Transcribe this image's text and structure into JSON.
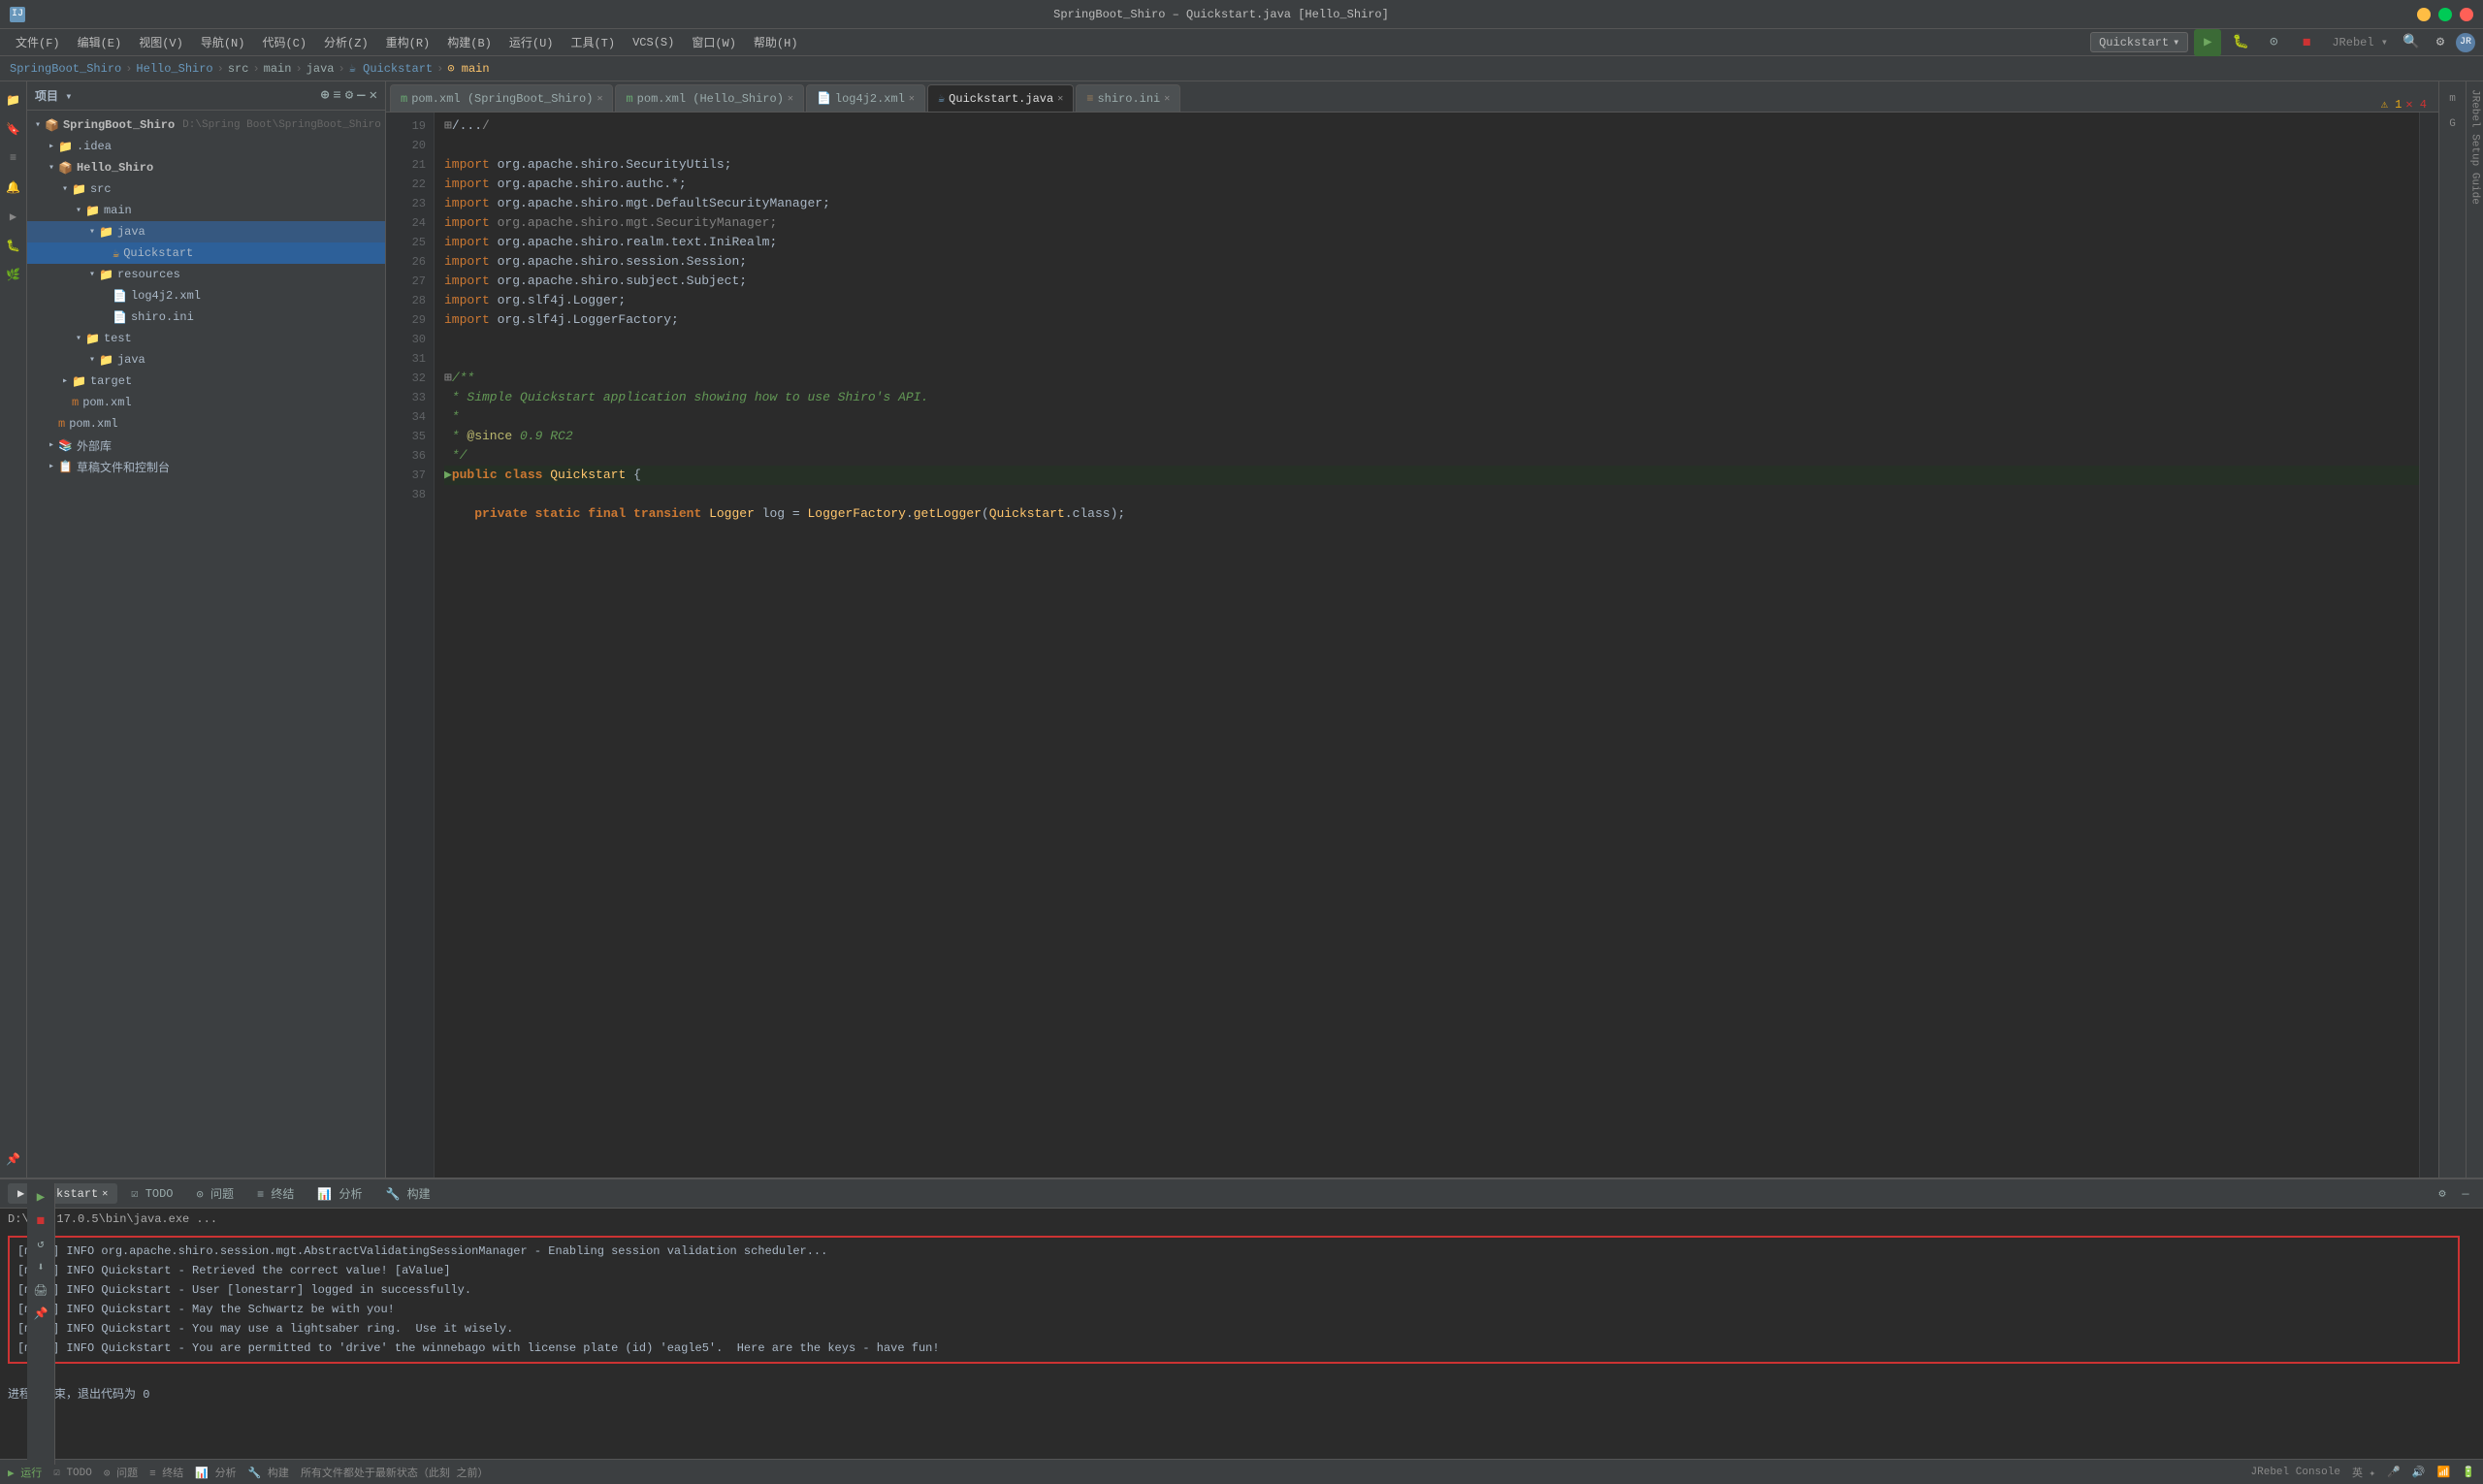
{
  "titlebar": {
    "title": "SpringBoot_Shiro – Quickstart.java [Hello_Shiro]",
    "minimize": "—",
    "maximize": "□",
    "close": "✕"
  },
  "menubar": {
    "items": [
      "文件(F)",
      "编辑(E)",
      "视图(V)",
      "导航(N)",
      "代码(C)",
      "分析(Z)",
      "重构(R)",
      "构建(B)",
      "运行(U)",
      "工具(T)",
      "VCS(S)",
      "窗口(W)",
      "帮助(H)"
    ]
  },
  "breadcrumb": {
    "items": [
      "SpringBoot_Shiro",
      "Hello_Shiro",
      "src",
      "main",
      "java",
      "Quickstart",
      "main"
    ]
  },
  "tabs": [
    {
      "label": "pom.xml (SpringBoot_Shiro)",
      "type": "xml",
      "active": false
    },
    {
      "label": "pom.xml (Hello_Shiro)",
      "type": "xml",
      "active": false
    },
    {
      "label": "log4j2.xml",
      "type": "xml",
      "active": false
    },
    {
      "label": "Quickstart.java",
      "type": "java",
      "active": true
    },
    {
      "label": "shiro.ini",
      "type": "ini",
      "active": false
    }
  ],
  "sidebar": {
    "title": "项目 ▾",
    "tree": [
      {
        "indent": 0,
        "arrow": "▾",
        "icon": "📦",
        "label": "SpringBoot_Shiro",
        "sub": "D:\\Spring Boot\\SpringBoot_Shiro",
        "type": "module"
      },
      {
        "indent": 1,
        "arrow": "▾",
        "icon": "📁",
        "label": ".idea",
        "type": "folder"
      },
      {
        "indent": 1,
        "arrow": "▾",
        "icon": "📁",
        "label": "Hello_Shiro",
        "type": "folder"
      },
      {
        "indent": 2,
        "arrow": "▾",
        "icon": "📁",
        "label": "src",
        "type": "folder"
      },
      {
        "indent": 3,
        "arrow": "▾",
        "icon": "📁",
        "label": "main",
        "type": "folder"
      },
      {
        "indent": 4,
        "arrow": "▾",
        "icon": "📁",
        "label": "java",
        "type": "folder",
        "selected": true
      },
      {
        "indent": 5,
        "arrow": " ",
        "icon": "☕",
        "label": "Quickstart",
        "type": "java"
      },
      {
        "indent": 4,
        "arrow": "▾",
        "icon": "📁",
        "label": "resources",
        "type": "folder"
      },
      {
        "indent": 5,
        "arrow": " ",
        "icon": "📄",
        "label": "log4j2.xml",
        "type": "xml"
      },
      {
        "indent": 5,
        "arrow": " ",
        "icon": "📄",
        "label": "shiro.ini",
        "type": "ini"
      },
      {
        "indent": 3,
        "arrow": "▾",
        "icon": "📁",
        "label": "test",
        "type": "folder"
      },
      {
        "indent": 4,
        "arrow": "▾",
        "icon": "📁",
        "label": "java",
        "type": "folder"
      },
      {
        "indent": 2,
        "arrow": "▾",
        "icon": "📁",
        "label": "target",
        "type": "folder"
      },
      {
        "indent": 2,
        "arrow": " ",
        "icon": "📄",
        "label": "pom.xml",
        "type": "xml"
      },
      {
        "indent": 1,
        "arrow": " ",
        "icon": "📄",
        "label": "pom.xml",
        "type": "xml"
      },
      {
        "indent": 1,
        "arrow": "▾",
        "icon": "📚",
        "label": "外部库",
        "type": "folder"
      },
      {
        "indent": 1,
        "arrow": "▾",
        "icon": "📋",
        "label": "草稿文件和控制台",
        "type": "folder"
      }
    ]
  },
  "editor": {
    "filename": "Quickstart.java",
    "lines": [
      {
        "num": "",
        "content": "/.../",
        "type": "fold"
      },
      {
        "num": "19",
        "content": "",
        "type": "blank"
      },
      {
        "num": "20",
        "content": "import org.apache.shiro.SecurityUtils;",
        "type": "import"
      },
      {
        "num": "21",
        "content": "import org.apache.shiro.authc.*;",
        "type": "import"
      },
      {
        "num": "22",
        "content": "import org.apache.shiro.mgt.DefaultSecurityManager;",
        "type": "import"
      },
      {
        "num": "23",
        "content": "import org.apache.shiro.mgt.SecurityManager;",
        "type": "import"
      },
      {
        "num": "24",
        "content": "import org.apache.shiro.realm.text.IniRealm;",
        "type": "import"
      },
      {
        "num": "25",
        "content": "import org.apache.shiro.session.Session;",
        "type": "import"
      },
      {
        "num": "26",
        "content": "import org.apache.shiro.subject.Subject;",
        "type": "import"
      },
      {
        "num": "27",
        "content": "import org.slf4j.Logger;",
        "type": "import"
      },
      {
        "num": "28",
        "content": "import org.slf4j.LoggerFactory;",
        "type": "import"
      },
      {
        "num": "29",
        "content": "",
        "type": "blank"
      },
      {
        "num": "30",
        "content": "",
        "type": "blank"
      },
      {
        "num": "31",
        "content": "/**",
        "type": "comment"
      },
      {
        "num": "32",
        "content": " * Simple Quickstart application showing how to use Shiro's API.",
        "type": "comment"
      },
      {
        "num": "33",
        "content": " *",
        "type": "comment"
      },
      {
        "num": "34",
        "content": " * @since 0.9 RC2",
        "type": "comment"
      },
      {
        "num": "35",
        "content": " */",
        "type": "comment"
      },
      {
        "num": "36",
        "content": "public class Quickstart {",
        "type": "class",
        "runnable": true
      },
      {
        "num": "37",
        "content": "",
        "type": "blank"
      },
      {
        "num": "38",
        "content": "    private static final transient Logger log = LoggerFactory.getLogger(Quickstart.class);",
        "type": "code"
      }
    ]
  },
  "console": {
    "run_tab": "Quickstart",
    "command": "D:\\jdk-17.0.5\\bin\\java.exe ...",
    "lines": [
      {
        "text": "[main] INFO org.apache.shiro.session.mgt.AbstractValidatingSessionManager - Enabling session validation scheduler...",
        "highlighted": true
      },
      {
        "text": "[main] INFO Quickstart - Retrieved the correct value! [aValue]",
        "highlighted": true
      },
      {
        "text": "[main] INFO Quickstart - User [lonestarr] logged in successfully.",
        "highlighted": true
      },
      {
        "text": "[main] INFO Quickstart - May the Schwartz be with you!",
        "highlighted": true
      },
      {
        "text": "[main] INFO Quickstart - You may use a lightsaber ring.  Use it wisely.",
        "highlighted": true
      },
      {
        "text": "[main] INFO Quickstart - You are permitted to 'drive' the winnebago with license plate (id) 'eagle5'.  Here are the keys - have fun!",
        "highlighted": true
      }
    ],
    "exit_msg": "进程已结束，退出代码为 0"
  },
  "statusbar": {
    "left": "所有文件都处于最新状态（此刻 之前）",
    "right": "英 ✦",
    "warning": "⚠ 1",
    "error": "✕ 4"
  },
  "bottom_tabs": [
    {
      "label": "▶ 运行",
      "active": false
    },
    {
      "label": "☑ TODO",
      "active": false
    },
    {
      "label": "⊙ 问题",
      "active": false
    },
    {
      "label": "≡ 终结",
      "active": false
    },
    {
      "label": "📊 分析",
      "active": false
    },
    {
      "label": "🔧 构建",
      "active": false
    }
  ]
}
